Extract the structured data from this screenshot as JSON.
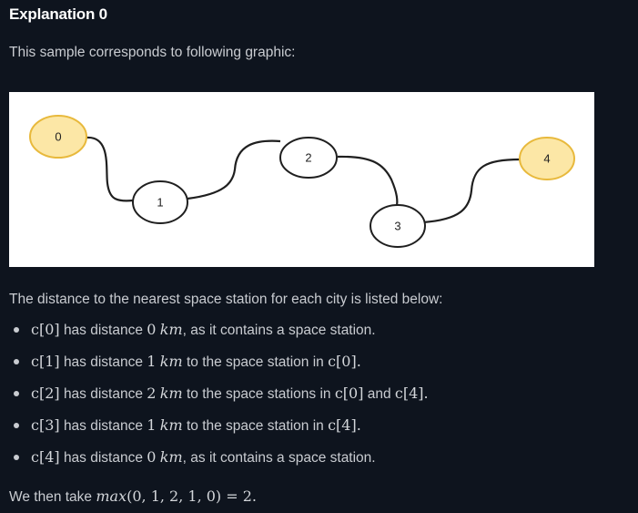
{
  "section": {
    "title": "Explanation 0",
    "intro": "This sample corresponds to following graphic:"
  },
  "graphic": {
    "nodes": [
      {
        "label": "0",
        "station": true
      },
      {
        "label": "1",
        "station": false
      },
      {
        "label": "2",
        "station": false
      },
      {
        "label": "3",
        "station": false
      },
      {
        "label": "4",
        "station": true
      }
    ],
    "colors": {
      "station_fill": "#fce7a6",
      "station_stroke": "#e8b93c",
      "city_fill": "#ffffff",
      "city_stroke": "#1f1f1f",
      "edge": "#1f1f1f"
    }
  },
  "explanation": {
    "lead": "The distance to the nearest space station for each city is listed below:",
    "items": [
      {
        "city": "c[0]",
        "has": "has distance",
        "distance": "0",
        "unit": "km",
        "tail_text": ", as it contains a space station.",
        "tail_math": ""
      },
      {
        "city": "c[1]",
        "has": "has distance",
        "distance": "1",
        "unit": "km",
        "tail_text": " to the space station in ",
        "tail_math": "c[0]."
      },
      {
        "city": "c[2]",
        "has": "has distance",
        "distance": "2",
        "unit": "km",
        "tail_text": " to the space stations in ",
        "tail_math": "c[0]",
        "tail_text2": " and ",
        "tail_math2": "c[4]."
      },
      {
        "city": "c[3]",
        "has": "has distance",
        "distance": "1",
        "unit": "km",
        "tail_text": " to the space station in ",
        "tail_math": "c[4]."
      },
      {
        "city": "c[4]",
        "has": "has distance",
        "distance": "0",
        "unit": "km",
        "tail_text": ", as it contains a space station.",
        "tail_math": ""
      }
    ],
    "conclusion_prefix": "We then take ",
    "conclusion_func": "max",
    "conclusion_args": "(0, 1, 2, 1, 0) = 2."
  }
}
